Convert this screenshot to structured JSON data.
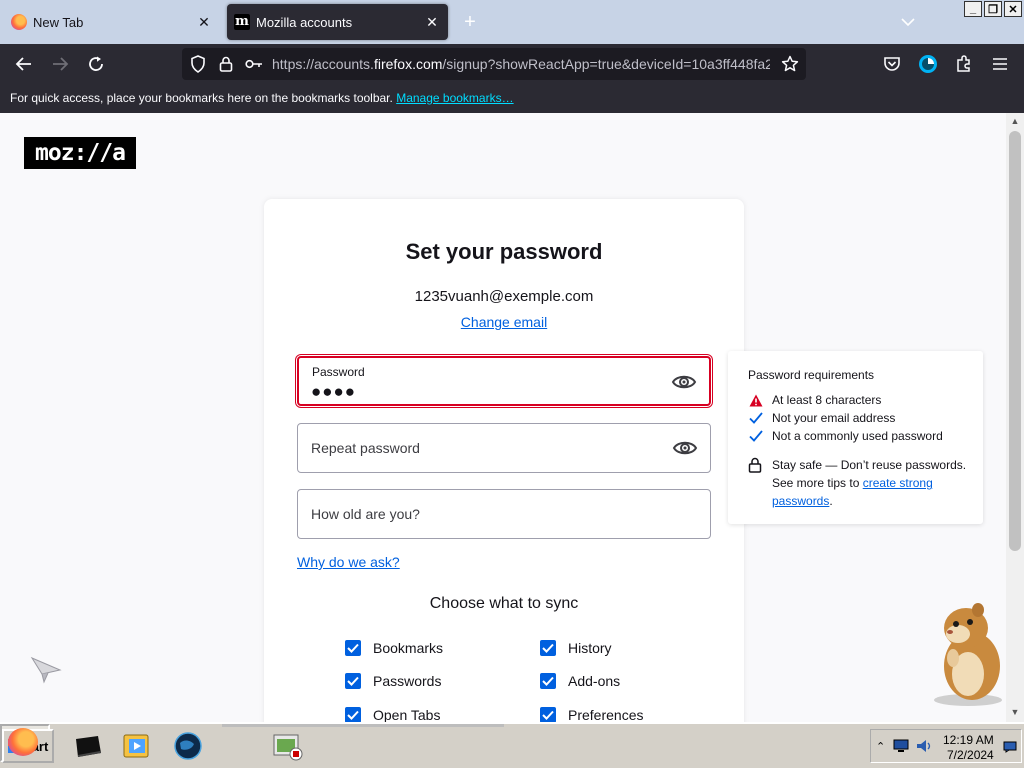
{
  "browser": {
    "tabs": [
      {
        "label": "New Tab",
        "icon": "firefox-icon",
        "active": false
      },
      {
        "label": "Mozilla accounts",
        "icon": "mozilla-m-icon",
        "active": true
      }
    ],
    "url": {
      "prefix": "https://accounts.",
      "host": "firefox.com",
      "suffix": "/signup?showReactApp=true&deviceId=10a3ff448fa2"
    },
    "bookmarks_bar": {
      "message": "For quick access, place your bookmarks here on the bookmarks toolbar.",
      "link": "Manage bookmarks…"
    }
  },
  "page": {
    "logo_text": "moz://a",
    "title": "Set your password",
    "email": "1235vuanh@exemple.com",
    "change_email_link": "Change email",
    "password": {
      "label": "Password",
      "masked_value": "●●●●"
    },
    "repeat_password": {
      "placeholder": "Repeat password"
    },
    "age": {
      "placeholder": "How old are you?"
    },
    "why_link": "Why do we ask?",
    "sync": {
      "title": "Choose what to sync",
      "items": [
        {
          "label": "Bookmarks",
          "checked": true
        },
        {
          "label": "History",
          "checked": true
        },
        {
          "label": "Passwords",
          "checked": true
        },
        {
          "label": "Add-ons",
          "checked": true
        },
        {
          "label": "Open Tabs",
          "checked": true
        },
        {
          "label": "Preferences",
          "checked": true
        }
      ]
    },
    "password_tooltip": {
      "title": "Password requirements",
      "requirements": [
        {
          "text": "At least 8 characters",
          "status": "error"
        },
        {
          "text": "Not your email address",
          "status": "ok"
        },
        {
          "text": "Not a commonly used password",
          "status": "ok"
        }
      ],
      "tip_text": "Stay safe — Don’t reuse passwords. See more tips to",
      "tip_link": "create strong passwords",
      "tip_end": "."
    }
  },
  "taskbar": {
    "start_label": "Start",
    "time": "12:19 AM",
    "date": "7/2/2024"
  },
  "colors": {
    "error": "#d70022",
    "link": "#0060df",
    "checkbox": "#0060df",
    "toolbar": "#2b2a33"
  }
}
